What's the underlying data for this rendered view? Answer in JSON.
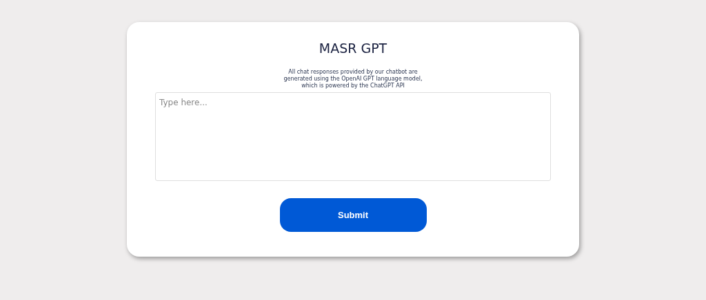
{
  "title": "MASR GPT",
  "disclaimer": [
    "All chat responses provided by our chatbot are",
    "generated using the OpenAI GPT language model,",
    "which is powered by the ChatGPT API"
  ],
  "input": {
    "placeholder": "Type here..."
  },
  "submit_button": "Submit"
}
